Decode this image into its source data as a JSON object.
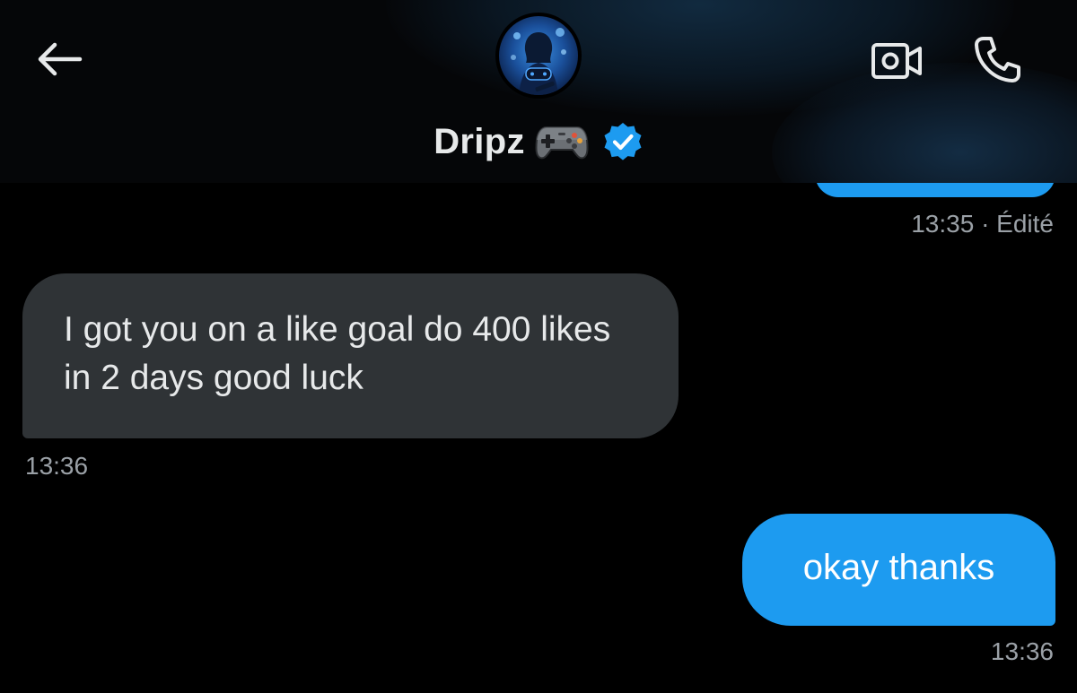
{
  "header": {
    "contact_name": "Dripz",
    "name_emoji_icon": "video-game-controller-icon",
    "verified_badge_icon": "verified-check-icon",
    "back_icon": "arrow-left-icon",
    "video_call_icon": "video-camera-icon",
    "voice_call_icon": "phone-icon",
    "verified_color": "#1d9bf0"
  },
  "messages": [
    {
      "direction": "sent",
      "partial": true,
      "timestamp": "13:35 · Édité"
    },
    {
      "direction": "received",
      "text": "I got you on a like goal do 400 likes in 2 days good luck",
      "timestamp": "13:36"
    },
    {
      "direction": "sent",
      "text": "okay thanks",
      "timestamp": "13:36"
    }
  ],
  "colors": {
    "background": "#000000",
    "sent_bubble": "#1d9bf0",
    "received_bubble": "#2f3336",
    "timestamp": "#9aa0a6",
    "text": "#e7e9ea"
  }
}
